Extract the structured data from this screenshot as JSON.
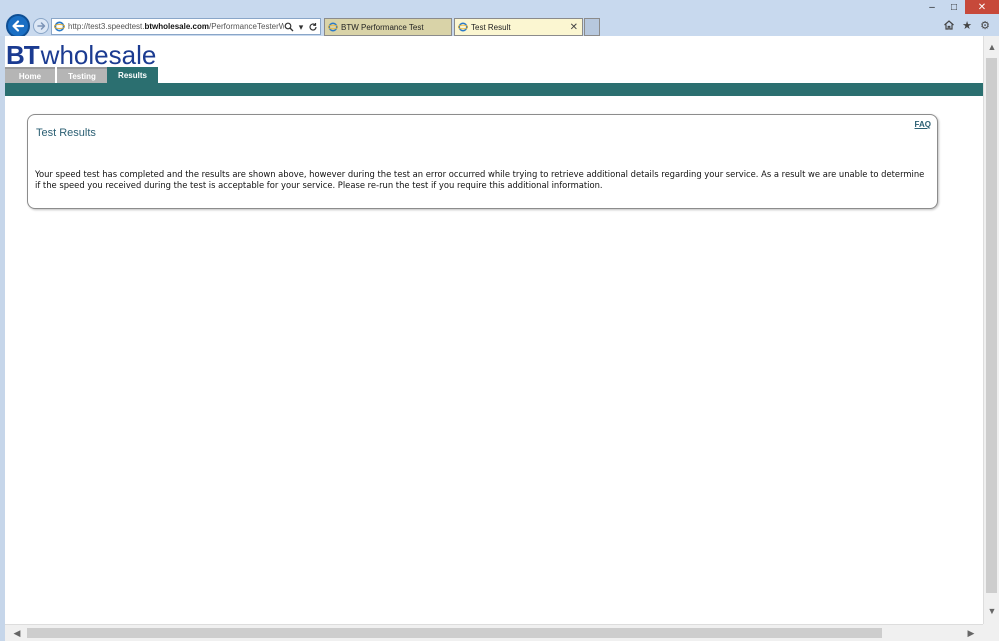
{
  "browser": {
    "address": {
      "url_prefix": "http://test3.speedtest.",
      "url_domain": "btwholesale.com",
      "url_suffix": "/PerformanceTesterWS/i"
    },
    "tabs": [
      {
        "label": "BTW Performance Test",
        "active": false
      },
      {
        "label": "Test Result",
        "active": true
      }
    ],
    "window_controls": {
      "minimize": "–",
      "maximize": "□",
      "close": "✕"
    }
  },
  "site": {
    "logo": {
      "bt": "BT",
      "wholesale": "wholesale"
    },
    "nav": [
      {
        "label": "Home",
        "active": false
      },
      {
        "label": "Testing",
        "active": false
      },
      {
        "label": "Results",
        "active": true
      }
    ],
    "colors": {
      "brand": "#1b3b91",
      "accent": "#2b6f70",
      "tab_inactive": "#b5b5b5"
    }
  },
  "results": {
    "title": "Test Results",
    "faq": "FAQ",
    "message": "Your speed test has completed and the results are shown above, however during the test an error occurred while trying to retrieve additional details regarding your service. As a result we are unable to determine if the speed you received during the test is acceptable for your service. Please re-run the test if you require this additional information."
  }
}
